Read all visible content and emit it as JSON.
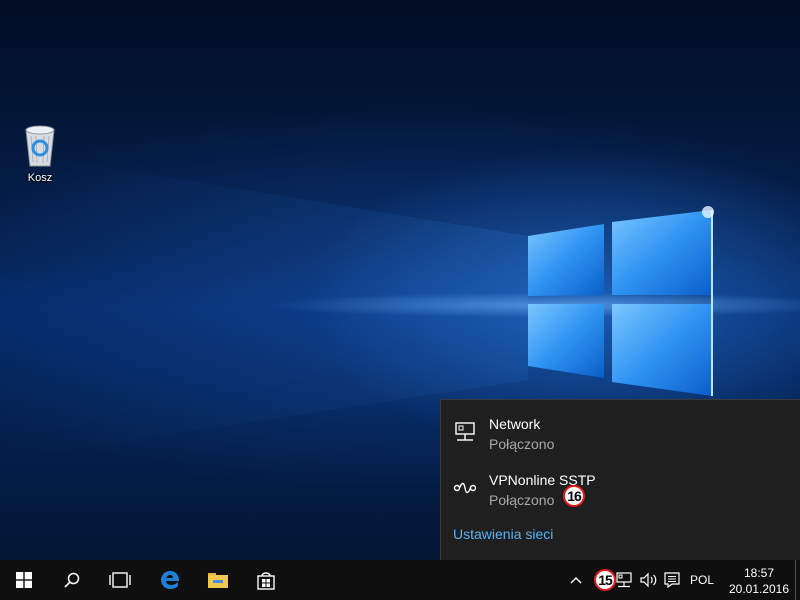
{
  "desktop": {
    "icons": [
      {
        "label": "Kosz",
        "icon": "recycle-bin-icon"
      }
    ]
  },
  "network_flyout": {
    "connections": [
      {
        "name": "Network",
        "status": "Połączono",
        "icon": "ethernet-icon"
      },
      {
        "name": "VPNonline SSTP",
        "status": "Połączono",
        "icon": "vpn-icon"
      }
    ],
    "settings_link": "Ustawienia sieci"
  },
  "callouts": {
    "vpn_status_badge": "16",
    "network_tray_badge": "15"
  },
  "taskbar": {
    "buttons": [
      {
        "icon": "start-windows-icon"
      },
      {
        "icon": "search-icon"
      },
      {
        "icon": "task-view-icon"
      },
      {
        "icon": "edge-browser-icon"
      },
      {
        "icon": "file-explorer-icon"
      },
      {
        "icon": "store-icon"
      }
    ],
    "tray": {
      "show_hidden_icon": "chevron-up-icon",
      "network_icon": "network-icon",
      "volume_icon": "volume-icon",
      "notifications_icon": "action-center-icon",
      "language": "POL",
      "time": "18:57",
      "date": "20.01.2016"
    }
  },
  "colors": {
    "taskbar_bg": "#0f0f0f",
    "flyout_bg": "#1f1f1f",
    "link": "#5eb0ef",
    "status_text": "#a8a8a8",
    "callout_border": "#e21b1b",
    "edge_blue": "#1e7fd6",
    "explorer_yellow": "#f2c94c"
  }
}
